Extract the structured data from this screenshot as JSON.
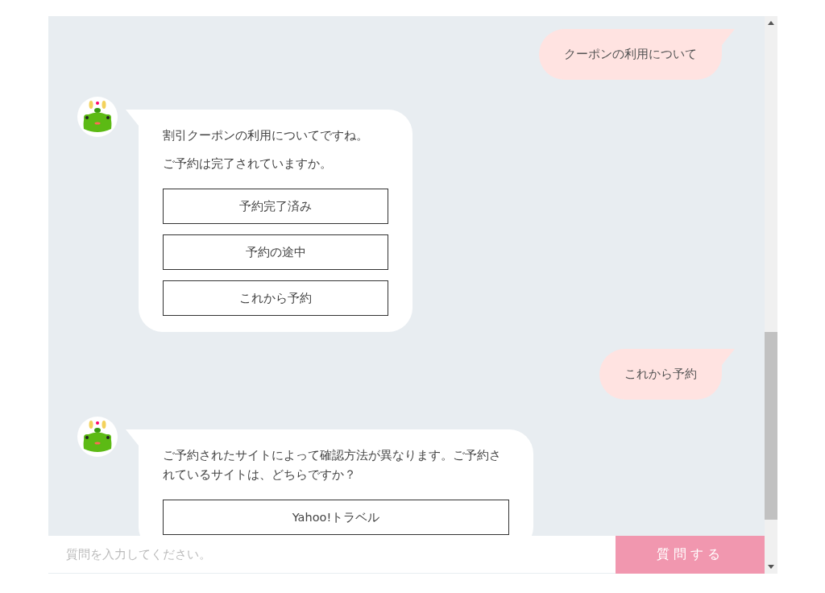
{
  "messages": [
    {
      "kind": "user",
      "text": "クーポンの利用について"
    },
    {
      "kind": "bot",
      "paragraphs": [
        "割引クーポンの利用についてですね。",
        "ご予約は完了されていますか。"
      ],
      "options": [
        "予約完了済み",
        "予約の途中",
        "これから予約"
      ]
    },
    {
      "kind": "user",
      "text": "これから予約"
    },
    {
      "kind": "bot",
      "paragraphs": [
        "ご予約されたサイトによって確認方法が異なります。ご予約されているサイトは、どちらですか？"
      ],
      "options": [
        "Yahoo!トラベル"
      ]
    }
  ],
  "composer": {
    "placeholder": "質問を入力してください。",
    "send_label": "質問する"
  }
}
